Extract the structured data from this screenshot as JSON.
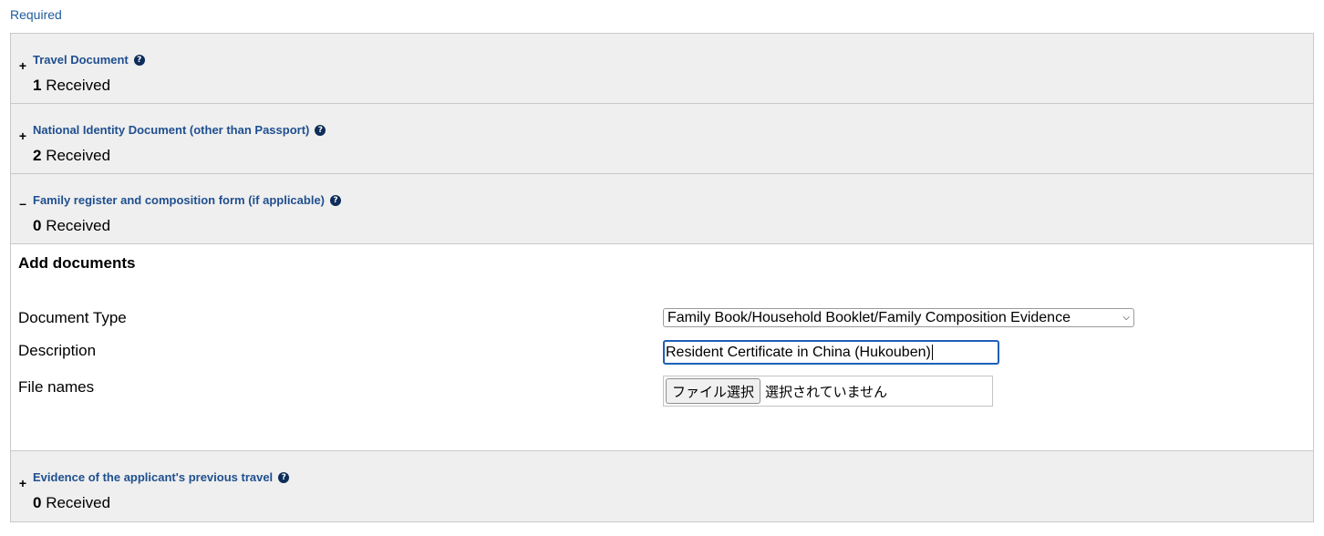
{
  "required_label": "Required",
  "sections_top": [
    {
      "toggle": "+",
      "title": "Travel Document",
      "count": "1",
      "received": "Received"
    },
    {
      "toggle": "+",
      "title": "National Identity Document (other than Passport)",
      "count": "2",
      "received": "Received"
    },
    {
      "toggle": "–",
      "title": "Family register and composition form (if applicable)",
      "count": "0",
      "received": "Received"
    }
  ],
  "help_icon": "?",
  "add_documents": {
    "title": "Add documents",
    "document_type_label": "Document Type",
    "document_type_value": "Family Book/Household Booklet/Family Composition Evidence",
    "description_label": "Description",
    "description_value": "Resident Certificate in China (Hukouben)",
    "file_names_label": "File names",
    "file_button_label": "ファイル選択",
    "file_status": "選択されていません"
  },
  "section_bottom": {
    "toggle": "+",
    "title": "Evidence of the applicant's previous travel",
    "count": "0",
    "received": "Received"
  }
}
